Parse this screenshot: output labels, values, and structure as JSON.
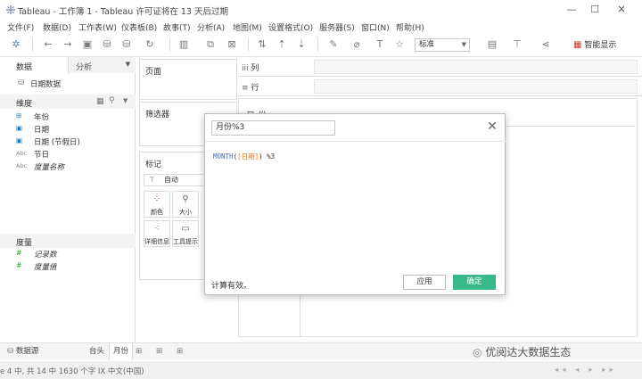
{
  "window": {
    "title": "Tableau - 工作簿 1 - Tableau 许可证将在 13 天后过期"
  },
  "menu": [
    "文件(F)",
    "数据(D)",
    "工作表(W)",
    "仪表板(B)",
    "故事(T)",
    "分析(A)",
    "地图(M)",
    "设置格式(O)",
    "服务器(S)",
    "窗口(N)",
    "帮助(H)"
  ],
  "toolbar": {
    "view_standard": "标准",
    "smart_show": "智能显示"
  },
  "left_pane": {
    "tab_data": "数据",
    "tab_analytics": "分析",
    "datasource": "日期数据",
    "dimensions_header": "维度",
    "dimensions": [
      {
        "icon": "date-icon",
        "label": "年份"
      },
      {
        "icon": "calendar-icon",
        "label": "日期"
      },
      {
        "icon": "calendar-icon",
        "label": "日期 (节假日)"
      },
      {
        "icon": "abc",
        "label": "节日"
      },
      {
        "icon": "abc",
        "label": "度量名称"
      }
    ],
    "measures_header": "度量",
    "measures": [
      {
        "icon": "measure-icon",
        "label": "记录数"
      },
      {
        "icon": "measure-icon",
        "label": "度量值"
      }
    ]
  },
  "shelves": {
    "pages": "页面",
    "filters": "筛选器",
    "marks": "标记",
    "marks_type": "自动",
    "mark_buttons": [
      "颜色",
      "大小",
      "详细信息",
      "工具提示"
    ],
    "columns": "列",
    "rows": "行"
  },
  "viz": {
    "partial_title": "日 份"
  },
  "dialog": {
    "calc_name": "月份%3",
    "formula_fn": "MONTH",
    "formula_open": "(",
    "formula_field": "[日期]",
    "formula_close": ")",
    "formula_op": "%3",
    "status": "计算有效。",
    "apply": "应用",
    "ok": "确定",
    "colors": {
      "function": "#3b6bb5",
      "field": "#e07b27",
      "ok_bg": "#39b98a"
    }
  },
  "bottom_tabs": {
    "datasource": "数据源",
    "sheet_prev": "台头",
    "sheet_current": "月份"
  },
  "status_bar": {
    "text": "e 4 中, 共 14 中    1630 个字    IX    中文(中国)"
  },
  "watermark": "优阅达大数据生态"
}
